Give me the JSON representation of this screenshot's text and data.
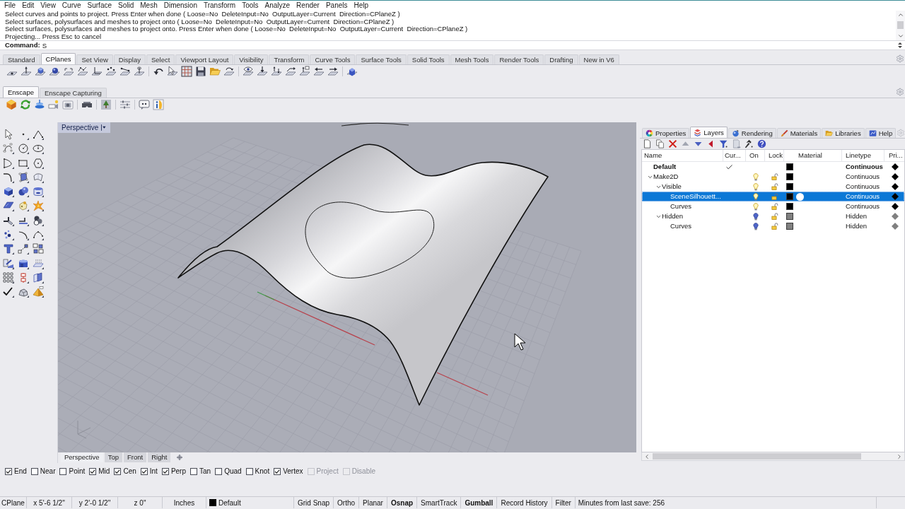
{
  "menu": [
    "File",
    "Edit",
    "View",
    "Curve",
    "Surface",
    "Solid",
    "Mesh",
    "Dimension",
    "Transform",
    "Tools",
    "Analyze",
    "Render",
    "Panels",
    "Help"
  ],
  "command_history": [
    "Select curves and points to project. Press Enter when done ( Loose=No  DeleteInput=No  OutputLayer=Current  Direction=CPlaneZ )",
    "Select surfaces, polysurfaces and meshes to project onto ( Loose=No  DeleteInput=No  OutputLayer=Current  Direction=CPlaneZ )",
    "Select surfaces, polysurfaces and meshes to project onto. Press Enter when done ( Loose=No  DeleteInput=No  OutputLayer=Current  Direction=CPlaneZ )",
    "Projecting... Press Esc to cancel"
  ],
  "command": {
    "prompt": "Command:",
    "value": "S"
  },
  "toolbar_tabs": [
    {
      "label": "Standard",
      "selected": false
    },
    {
      "label": "CPlanes",
      "selected": true
    },
    {
      "label": "Set View",
      "selected": false
    },
    {
      "label": "Display",
      "selected": false
    },
    {
      "label": "Select",
      "selected": false
    },
    {
      "label": "Viewport Layout",
      "selected": false
    },
    {
      "label": "Visibility",
      "selected": false
    },
    {
      "label": "Transform",
      "selected": false
    },
    {
      "label": "Curve Tools",
      "selected": false
    },
    {
      "label": "Surface Tools",
      "selected": false
    },
    {
      "label": "Solid Tools",
      "selected": false
    },
    {
      "label": "Mesh Tools",
      "selected": false
    },
    {
      "label": "Render Tools",
      "selected": false
    },
    {
      "label": "Drafting",
      "selected": false
    },
    {
      "label": "New in V6",
      "selected": false
    }
  ],
  "plugin_tabs": [
    {
      "label": "Enscape",
      "selected": true
    },
    {
      "label": "Enscape Capturing",
      "selected": false
    }
  ],
  "viewport": {
    "title": "Perspective"
  },
  "viewport_tabs": [
    {
      "label": "Perspective",
      "selected": true
    },
    {
      "label": "Top",
      "selected": false
    },
    {
      "label": "Front",
      "selected": false
    },
    {
      "label": "Right",
      "selected": false
    }
  ],
  "panel_tabs": [
    {
      "label": "Properties",
      "selected": false
    },
    {
      "label": "Layers",
      "selected": true
    },
    {
      "label": "Rendering",
      "selected": false
    },
    {
      "label": "Materials",
      "selected": false
    },
    {
      "label": "Libraries",
      "selected": false
    },
    {
      "label": "Help",
      "selected": false
    }
  ],
  "layers": {
    "columns": [
      "Name",
      "Cur...",
      "On",
      "Lock",
      "Material",
      "Linetype",
      "Pri..."
    ],
    "items": [
      {
        "name": "Default",
        "selected": false,
        "current": true,
        "color": "#000000",
        "linetype": "Continuous",
        "print_swatch": {
          "color": "#000000"
        }
      },
      {
        "name": "Make2D",
        "selected": false,
        "current": false,
        "expanded": true,
        "on": true,
        "locked": false,
        "color": "#000000",
        "linetype": "Continuous",
        "print_swatch": {
          "color": "#000000"
        },
        "children": [
          {
            "name": "Visible",
            "selected": false,
            "current": false,
            "expanded": true,
            "on": true,
            "locked": false,
            "color": "#000000",
            "linetype": "Continuous",
            "print_swatch": {
              "color": "#000000"
            },
            "children": [
              {
                "name": "SceneSilhouett...",
                "selected": true,
                "current": false,
                "on": true,
                "locked": false,
                "color": "#000000",
                "linetype": "Continuous",
                "print_swatch": {
                  "color": "#000000"
                }
              },
              {
                "name": "Curves",
                "selected": false,
                "current": false,
                "on": true,
                "locked": false,
                "color": "#000000",
                "linetype": "Continuous",
                "print_swatch": {
                  "color": "#000000"
                }
              }
            ]
          },
          {
            "name": "Hidden",
            "selected": false,
            "current": false,
            "expanded": true,
            "on": false,
            "locked": false,
            "color": "#808080",
            "linetype": "Hidden",
            "print_swatch": {
              "color": "#808080"
            },
            "children": [
              {
                "name": "Curves",
                "selected": false,
                "current": false,
                "on": false,
                "locked": false,
                "color": "#808080",
                "linetype": "Hidden",
                "print_swatch": {
                  "color": "#808080"
                }
              }
            ]
          }
        ]
      }
    ]
  },
  "osnaps": [
    {
      "label": "End",
      "checked": true,
      "disabled": false
    },
    {
      "label": "Near",
      "checked": false,
      "disabled": false
    },
    {
      "label": "Point",
      "checked": false,
      "disabled": false
    },
    {
      "label": "Mid",
      "checked": true,
      "disabled": false
    },
    {
      "label": "Cen",
      "checked": true,
      "disabled": false
    },
    {
      "label": "Int",
      "checked": true,
      "disabled": false
    },
    {
      "label": "Perp",
      "checked": true,
      "disabled": false
    },
    {
      "label": "Tan",
      "checked": false,
      "disabled": false
    },
    {
      "label": "Quad",
      "checked": false,
      "disabled": false
    },
    {
      "label": "Knot",
      "checked": false,
      "disabled": false
    },
    {
      "label": "Vertex",
      "checked": true,
      "disabled": false
    },
    {
      "label": "Project",
      "checked": false,
      "disabled": true
    },
    {
      "label": "Disable",
      "checked": false,
      "disabled": true
    }
  ],
  "status_bar": {
    "cplane": "CPlane",
    "x": "x 5'-6 1/2\"",
    "y": "y 2'-0 1/2\"",
    "z": "z 0\"",
    "units": "Inches",
    "layer": {
      "name": "Default",
      "color": "#000000"
    },
    "toggles": [
      {
        "label": "Grid Snap",
        "on": false
      },
      {
        "label": "Ortho",
        "on": false
      },
      {
        "label": "Planar",
        "on": false
      },
      {
        "label": "Osnap",
        "on": true
      },
      {
        "label": "SmartTrack",
        "on": false
      },
      {
        "label": "Gumball",
        "on": true
      },
      {
        "label": "Record History",
        "on": false
      },
      {
        "label": "Filter",
        "on": false
      }
    ],
    "save_info": "Minutes from last save: 256"
  }
}
